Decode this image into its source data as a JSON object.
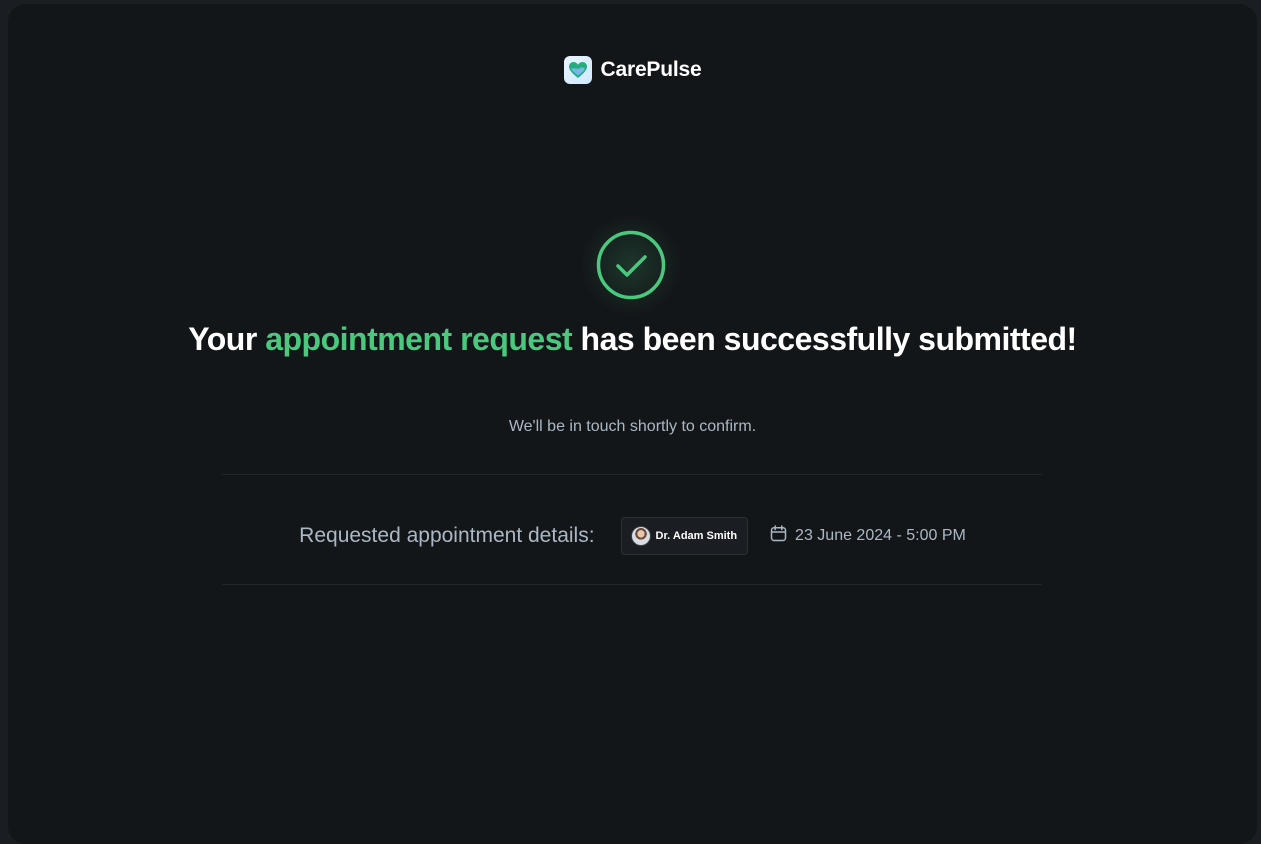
{
  "brand": {
    "name": "CarePulse",
    "logo_icon": "heart-logo-icon"
  },
  "success": {
    "icon": "check-circle-icon",
    "headline_before": "Your ",
    "headline_accent": "appointment request",
    "headline_after": " has been successfully submitted!",
    "subtext": "We'll be in touch shortly to confirm.",
    "accent_color": "#4ac97e"
  },
  "details": {
    "label": "Requested appointment details:",
    "doctor_name": "Dr. Adam Smith",
    "doctor_avatar": "doctor-avatar",
    "calendar_icon": "calendar-icon",
    "datetime": "23 June 2024 - 5:00 PM"
  }
}
